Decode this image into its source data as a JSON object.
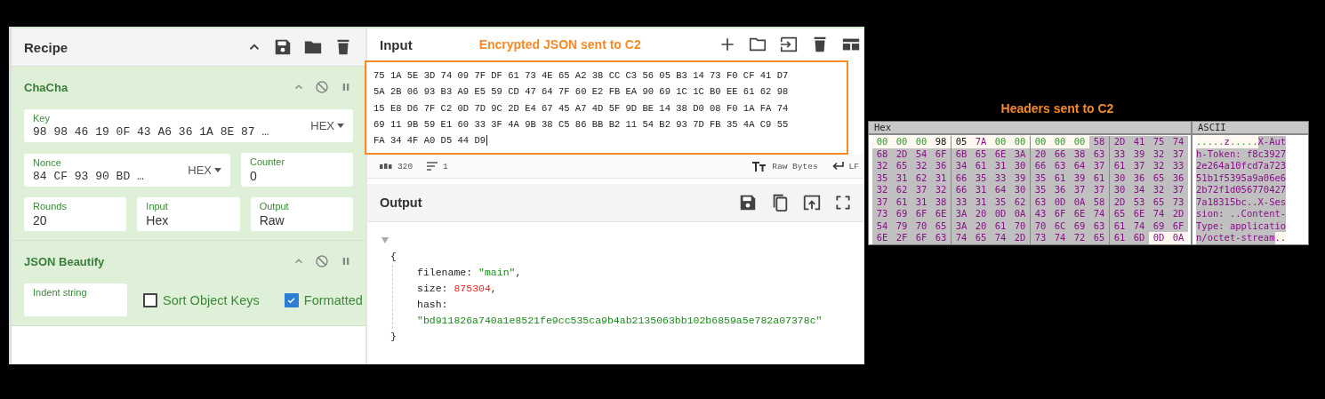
{
  "recipe": {
    "title": "Recipe",
    "operations": [
      {
        "kind": "chacha",
        "title": "ChaCha",
        "key": {
          "label": "Key",
          "value": "98 98 46 19 0F 43 A6 36 1A 8E 87 …",
          "option": "HEX"
        },
        "nonce": {
          "label": "Nonce",
          "value": "84 CF 93 90 BD …",
          "option": "HEX"
        },
        "counter": {
          "label": "Counter",
          "value": "0"
        },
        "rounds": {
          "label": "Rounds",
          "value": "20"
        },
        "input": {
          "label": "Input",
          "value": "Hex"
        },
        "output": {
          "label": "Output",
          "value": "Raw"
        }
      },
      {
        "kind": "beautify",
        "title": "JSON Beautify",
        "indent": {
          "label": "Indent string"
        },
        "sort_keys": {
          "label": "Sort Object Keys",
          "checked": false
        },
        "formatted": {
          "label": "Formatted",
          "checked": true
        }
      }
    ]
  },
  "input": {
    "title": "Input",
    "annotation": "Encrypted JSON sent to C2",
    "lines": [
      "75 1A 5E 3D 74 09 7F DF 61 73 4E 65 A2 38 CC C3 56 05 B3 14 73 F0 CF 41 D7",
      "5A 2B 06 93 B3 A9 E5 59 CD 47 64 7F 60 E2 FB EA 90 69 1C 1C B0 EE 61 62 98",
      "15 E8 D6 7F C2 0D 7D 9C 2D E4 67 45 A7 4D 5F 9D BE 14 38 D0 08 F0 1A FA 74",
      "69 11 9B 59 E1 60 33 3F 4A 9B 38 C5 86 BB B2 11 54 B2 93 7D FB 35 4A C9 55",
      "FA 34 4F A0 D5 44 D9"
    ],
    "status": {
      "length": "320",
      "lines": "1",
      "encoding": "Raw Bytes",
      "eol": "LF"
    }
  },
  "output": {
    "title": "Output",
    "open": "{",
    "close": "}",
    "entries": [
      {
        "key": "filename:",
        "value": "\"main\"",
        "kind": "string",
        "sep": ","
      },
      {
        "key": "size:",
        "value": "875304",
        "kind": "number",
        "sep": ","
      },
      {
        "key": "hash:",
        "value": "\"bd911826a740a1e8521fe9cc535ca9b4ab2135063bb102b6859a5e782a07378c\"",
        "kind": "string"
      }
    ]
  },
  "hex_view": {
    "annotation": "Headers sent to C2",
    "hex_title": "Hex",
    "ascii_title": "ASCII",
    "rows": [
      {
        "cells": [
          {
            "b": "00",
            "kind": "null",
            "selected": false
          },
          {
            "b": "00",
            "kind": "null",
            "selected": false
          },
          {
            "b": "00",
            "kind": "null",
            "selected": false
          },
          {
            "b": "98",
            "kind": "byte",
            "selected": false
          },
          {
            "b": "05",
            "kind": "byte",
            "selected": false
          },
          {
            "b": "7A",
            "kind": "text",
            "selected": false
          },
          {
            "b": "00",
            "kind": "null",
            "selected": false
          },
          {
            "b": "00",
            "kind": "null",
            "selected": false
          },
          {
            "b": "00",
            "kind": "null",
            "selected": false
          },
          {
            "b": "00",
            "kind": "null",
            "selected": false
          },
          {
            "b": "00",
            "kind": "null",
            "selected": false
          },
          {
            "b": "58",
            "kind": "text",
            "selected": true
          },
          {
            "b": "2D",
            "kind": "text",
            "selected": true
          },
          {
            "b": "41",
            "kind": "text",
            "selected": true
          },
          {
            "b": "75",
            "kind": "text",
            "selected": true
          },
          {
            "b": "74",
            "kind": "text",
            "selected": true
          }
        ],
        "ascii": [
          {
            "text": ".....",
            "kind": "null",
            "selected": false
          },
          {
            "text": "z",
            "kind": "text",
            "selected": false
          },
          {
            "text": ".....",
            "kind": "null",
            "selected": false
          },
          {
            "text": "X-Aut",
            "kind": "text",
            "selected": true
          }
        ]
      },
      {
        "cells": [
          {
            "b": "68",
            "kind": "text",
            "selected": true
          },
          {
            "b": "2D",
            "kind": "text",
            "selected": true
          },
          {
            "b": "54",
            "kind": "text",
            "selected": true
          },
          {
            "b": "6F",
            "kind": "text",
            "selected": true
          },
          {
            "b": "6B",
            "kind": "text",
            "selected": true
          },
          {
            "b": "65",
            "kind": "text",
            "selected": true
          },
          {
            "b": "6E",
            "kind": "text",
            "selected": true
          },
          {
            "b": "3A",
            "kind": "text",
            "selected": true
          },
          {
            "b": "20",
            "kind": "text",
            "selected": true
          },
          {
            "b": "66",
            "kind": "text",
            "selected": true
          },
          {
            "b": "38",
            "kind": "text",
            "selected": true
          },
          {
            "b": "63",
            "kind": "text",
            "selected": true
          },
          {
            "b": "33",
            "kind": "text",
            "selected": true
          },
          {
            "b": "39",
            "kind": "text",
            "selected": true
          },
          {
            "b": "32",
            "kind": "text",
            "selected": true
          },
          {
            "b": "37",
            "kind": "text",
            "selected": true
          }
        ],
        "ascii": [
          {
            "text": "h-Token: f8c3927",
            "kind": "text",
            "selected": true
          }
        ]
      },
      {
        "cells": [
          {
            "b": "32",
            "kind": "text",
            "selected": true
          },
          {
            "b": "65",
            "kind": "text",
            "selected": true
          },
          {
            "b": "32",
            "kind": "text",
            "selected": true
          },
          {
            "b": "36",
            "kind": "text",
            "selected": true
          },
          {
            "b": "34",
            "kind": "text",
            "selected": true
          },
          {
            "b": "61",
            "kind": "text",
            "selected": true
          },
          {
            "b": "31",
            "kind": "text",
            "selected": true
          },
          {
            "b": "30",
            "kind": "text",
            "selected": true
          },
          {
            "b": "66",
            "kind": "text",
            "selected": true
          },
          {
            "b": "63",
            "kind": "text",
            "selected": true
          },
          {
            "b": "64",
            "kind": "text",
            "selected": true
          },
          {
            "b": "37",
            "kind": "text",
            "selected": true
          },
          {
            "b": "61",
            "kind": "text",
            "selected": true
          },
          {
            "b": "37",
            "kind": "text",
            "selected": true
          },
          {
            "b": "32",
            "kind": "text",
            "selected": true
          },
          {
            "b": "33",
            "kind": "text",
            "selected": true
          }
        ],
        "ascii": [
          {
            "text": "2e264a10fcd7a723",
            "kind": "text",
            "selected": true
          }
        ]
      },
      {
        "cells": [
          {
            "b": "35",
            "kind": "text",
            "selected": true
          },
          {
            "b": "31",
            "kind": "text",
            "selected": true
          },
          {
            "b": "62",
            "kind": "text",
            "selected": true
          },
          {
            "b": "31",
            "kind": "text",
            "selected": true
          },
          {
            "b": "66",
            "kind": "text",
            "selected": true
          },
          {
            "b": "35",
            "kind": "text",
            "selected": true
          },
          {
            "b": "33",
            "kind": "text",
            "selected": true
          },
          {
            "b": "39",
            "kind": "text",
            "selected": true
          },
          {
            "b": "35",
            "kind": "text",
            "selected": true
          },
          {
            "b": "61",
            "kind": "text",
            "selected": true
          },
          {
            "b": "39",
            "kind": "text",
            "selected": true
          },
          {
            "b": "61",
            "kind": "text",
            "selected": true
          },
          {
            "b": "30",
            "kind": "text",
            "selected": true
          },
          {
            "b": "36",
            "kind": "text",
            "selected": true
          },
          {
            "b": "65",
            "kind": "text",
            "selected": true
          },
          {
            "b": "36",
            "kind": "text",
            "selected": true
          }
        ],
        "ascii": [
          {
            "text": "51b1f5395a9a06e6",
            "kind": "text",
            "selected": true
          }
        ]
      },
      {
        "cells": [
          {
            "b": "32",
            "kind": "text",
            "selected": true
          },
          {
            "b": "62",
            "kind": "text",
            "selected": true
          },
          {
            "b": "37",
            "kind": "text",
            "selected": true
          },
          {
            "b": "32",
            "kind": "text",
            "selected": true
          },
          {
            "b": "66",
            "kind": "text",
            "selected": true
          },
          {
            "b": "31",
            "kind": "text",
            "selected": true
          },
          {
            "b": "64",
            "kind": "text",
            "selected": true
          },
          {
            "b": "30",
            "kind": "text",
            "selected": true
          },
          {
            "b": "35",
            "kind": "text",
            "selected": true
          },
          {
            "b": "36",
            "kind": "text",
            "selected": true
          },
          {
            "b": "37",
            "kind": "text",
            "selected": true
          },
          {
            "b": "37",
            "kind": "text",
            "selected": true
          },
          {
            "b": "30",
            "kind": "text",
            "selected": true
          },
          {
            "b": "34",
            "kind": "text",
            "selected": true
          },
          {
            "b": "32",
            "kind": "text",
            "selected": true
          },
          {
            "b": "37",
            "kind": "text",
            "selected": true
          }
        ],
        "ascii": [
          {
            "text": "2b72f1d056770427",
            "kind": "text",
            "selected": true
          }
        ]
      },
      {
        "cells": [
          {
            "b": "37",
            "kind": "text",
            "selected": true
          },
          {
            "b": "61",
            "kind": "text",
            "selected": true
          },
          {
            "b": "31",
            "kind": "text",
            "selected": true
          },
          {
            "b": "38",
            "kind": "text",
            "selected": true
          },
          {
            "b": "33",
            "kind": "text",
            "selected": true
          },
          {
            "b": "31",
            "kind": "text",
            "selected": true
          },
          {
            "b": "35",
            "kind": "text",
            "selected": true
          },
          {
            "b": "62",
            "kind": "text",
            "selected": true
          },
          {
            "b": "63",
            "kind": "text",
            "selected": true
          },
          {
            "b": "0D",
            "kind": "text",
            "selected": true
          },
          {
            "b": "0A",
            "kind": "text",
            "selected": true
          },
          {
            "b": "58",
            "kind": "text",
            "selected": true
          },
          {
            "b": "2D",
            "kind": "text",
            "selected": true
          },
          {
            "b": "53",
            "kind": "text",
            "selected": true
          },
          {
            "b": "65",
            "kind": "text",
            "selected": true
          },
          {
            "b": "73",
            "kind": "text",
            "selected": true
          }
        ],
        "ascii": [
          {
            "text": "7a18315bc..X-Ses",
            "kind": "text",
            "selected": true
          }
        ]
      },
      {
        "cells": [
          {
            "b": "73",
            "kind": "text",
            "selected": true
          },
          {
            "b": "69",
            "kind": "text",
            "selected": true
          },
          {
            "b": "6F",
            "kind": "text",
            "selected": true
          },
          {
            "b": "6E",
            "kind": "text",
            "selected": true
          },
          {
            "b": "3A",
            "kind": "text",
            "selected": true
          },
          {
            "b": "20",
            "kind": "text",
            "selected": true
          },
          {
            "b": "0D",
            "kind": "text",
            "selected": true
          },
          {
            "b": "0A",
            "kind": "text",
            "selected": true
          },
          {
            "b": "43",
            "kind": "text",
            "selected": true
          },
          {
            "b": "6F",
            "kind": "text",
            "selected": true
          },
          {
            "b": "6E",
            "kind": "text",
            "selected": true
          },
          {
            "b": "74",
            "kind": "text",
            "selected": true
          },
          {
            "b": "65",
            "kind": "text",
            "selected": true
          },
          {
            "b": "6E",
            "kind": "text",
            "selected": true
          },
          {
            "b": "74",
            "kind": "text",
            "selected": true
          },
          {
            "b": "2D",
            "kind": "text",
            "selected": true
          }
        ],
        "ascii": [
          {
            "text": "sion: ..Content-",
            "kind": "text",
            "selected": true
          }
        ]
      },
      {
        "cells": [
          {
            "b": "54",
            "kind": "text",
            "selected": true
          },
          {
            "b": "79",
            "kind": "text",
            "selected": true
          },
          {
            "b": "70",
            "kind": "text",
            "selected": true
          },
          {
            "b": "65",
            "kind": "text",
            "selected": true
          },
          {
            "b": "3A",
            "kind": "text",
            "selected": true
          },
          {
            "b": "20",
            "kind": "text",
            "selected": true
          },
          {
            "b": "61",
            "kind": "text",
            "selected": true
          },
          {
            "b": "70",
            "kind": "text",
            "selected": true
          },
          {
            "b": "70",
            "kind": "text",
            "selected": true
          },
          {
            "b": "6C",
            "kind": "text",
            "selected": true
          },
          {
            "b": "69",
            "kind": "text",
            "selected": true
          },
          {
            "b": "63",
            "kind": "text",
            "selected": true
          },
          {
            "b": "61",
            "kind": "text",
            "selected": true
          },
          {
            "b": "74",
            "kind": "text",
            "selected": true
          },
          {
            "b": "69",
            "kind": "text",
            "selected": true
          },
          {
            "b": "6F",
            "kind": "text",
            "selected": true
          }
        ],
        "ascii": [
          {
            "text": "Type: applicatio",
            "kind": "text",
            "selected": true
          }
        ]
      },
      {
        "cells": [
          {
            "b": "6E",
            "kind": "text",
            "selected": true
          },
          {
            "b": "2F",
            "kind": "text",
            "selected": true
          },
          {
            "b": "6F",
            "kind": "text",
            "selected": true
          },
          {
            "b": "63",
            "kind": "text",
            "selected": true
          },
          {
            "b": "74",
            "kind": "text",
            "selected": true
          },
          {
            "b": "65",
            "kind": "text",
            "selected": true
          },
          {
            "b": "74",
            "kind": "text",
            "selected": true
          },
          {
            "b": "2D",
            "kind": "text",
            "selected": true
          },
          {
            "b": "73",
            "kind": "text",
            "selected": true
          },
          {
            "b": "74",
            "kind": "text",
            "selected": true
          },
          {
            "b": "72",
            "kind": "text",
            "selected": true
          },
          {
            "b": "65",
            "kind": "text",
            "selected": true
          },
          {
            "b": "61",
            "kind": "text",
            "selected": true
          },
          {
            "b": "6D",
            "kind": "text",
            "selected": true
          },
          {
            "b": "0D",
            "kind": "text",
            "selected": false
          },
          {
            "b": "0A",
            "kind": "text",
            "selected": false
          }
        ],
        "ascii": [
          {
            "text": "n/octet-stream",
            "kind": "text",
            "selected": true
          },
          {
            "text": "..",
            "kind": "text",
            "selected": false
          }
        ]
      }
    ]
  }
}
